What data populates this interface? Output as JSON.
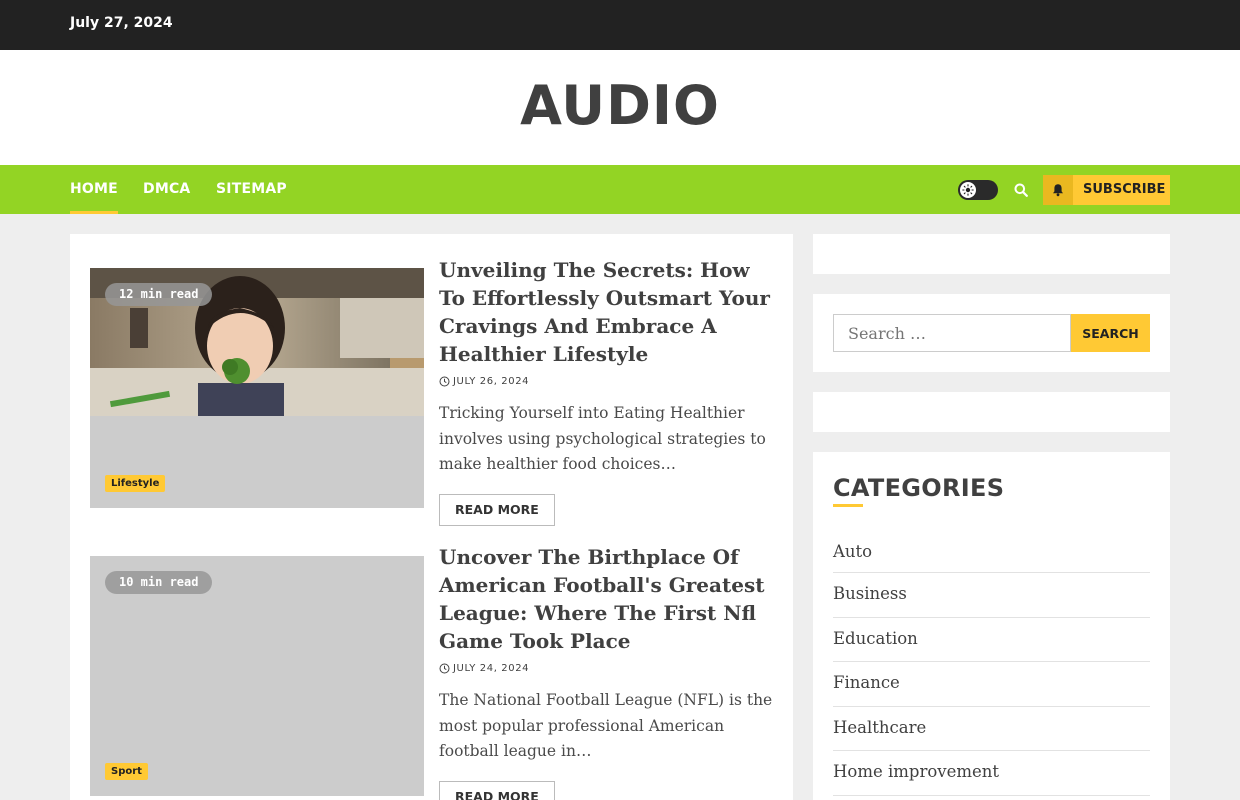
{
  "topbar": {
    "date": "July 27, 2024"
  },
  "site": {
    "title": "AUDIO"
  },
  "nav": {
    "items": [
      {
        "label": "HOME"
      },
      {
        "label": "DMCA"
      },
      {
        "label": "SITEMAP"
      }
    ],
    "subscribe_label": "SUBSCRIBE"
  },
  "posts": [
    {
      "read_time": "12 min read",
      "category": "Lifestyle",
      "title": "Unveiling The Secrets: How To Effortlessly Outsmart Your Cravings And Embrace A Healthier Lifestyle",
      "date": "JULY 26, 2024",
      "excerpt": "Tricking Yourself into Eating Healthier involves using psychological strategies to make healthier food choices…",
      "read_more": "READ MORE"
    },
    {
      "read_time": "10 min read",
      "category": "Sport",
      "title": "Uncover The Birthplace Of American Football's Greatest League: Where The First Nfl Game Took Place",
      "date": "JULY 24, 2024",
      "excerpt": "The National Football League (NFL) is the most popular professional American football league in…",
      "read_more": "READ MORE"
    }
  ],
  "sidebar": {
    "search": {
      "placeholder": "Search …",
      "button_label": "SEARCH"
    },
    "categories": {
      "heading": "CATEGORIES",
      "items": [
        "Auto",
        "Business",
        "Education",
        "Finance",
        "Healthcare",
        "Home improvement"
      ]
    }
  },
  "colors": {
    "accent_green": "#93d424",
    "accent_yellow": "#ffc934",
    "topbar": "#222222"
  }
}
